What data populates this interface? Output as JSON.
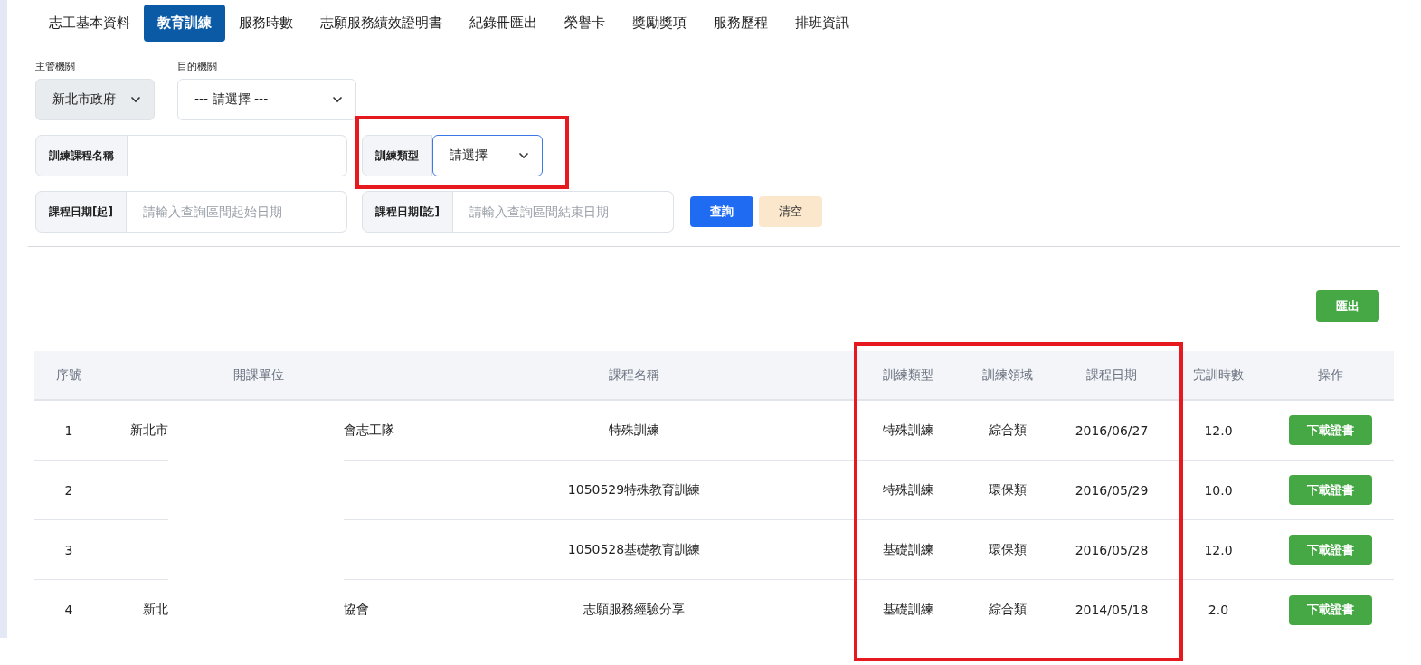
{
  "tabs": [
    {
      "label": "志工基本資料",
      "selected": false
    },
    {
      "label": "教育訓練",
      "selected": true
    },
    {
      "label": "服務時數",
      "selected": false
    },
    {
      "label": "志願服務績效證明書",
      "selected": false
    },
    {
      "label": "紀錄冊匯出",
      "selected": false
    },
    {
      "label": "榮譽卡",
      "selected": false
    },
    {
      "label": "獎勵獎項",
      "selected": false
    },
    {
      "label": "服務歷程",
      "selected": false
    },
    {
      "label": "排班資訊",
      "selected": false
    }
  ],
  "agency_selects": [
    {
      "label": "主管機關",
      "value": "新北市政府",
      "disabled": true
    },
    {
      "label": "目的機關",
      "value": "--- 請選擇 ---",
      "disabled": false
    }
  ],
  "filter_rows": [
    [
      {
        "kind": "input",
        "label": "訓練課程名稱",
        "focused": false
      },
      {
        "kind": "select",
        "label": "訓練類型",
        "value": "請選擇",
        "focused": true
      }
    ],
    [
      {
        "kind": "input",
        "label": "課程日期[起]",
        "placeholder": "請輸入查詢區間起始日期",
        "focused": false
      },
      {
        "kind": "input",
        "label": "課程日期[訖]",
        "placeholder": "請輸入查詢區間結束日期",
        "focused": false
      }
    ]
  ],
  "filter_buttons": [
    {
      "kind": "primary",
      "label": "查詢"
    },
    {
      "kind": "secondary",
      "label": "清空"
    }
  ],
  "export_button": "匯出",
  "table": {
    "columns": [
      "序號",
      "開課單位",
      "課程名稱",
      "訓練類型",
      "訓練領域",
      "課程日期",
      "完訓時數",
      "操作"
    ],
    "rows": [
      {
        "no": "1",
        "organizer_start": "新北市",
        "organizer_end": "會志工隊",
        "course": "特殊訓練",
        "type": "特殊訓練",
        "field": "綜合類",
        "date": "2016/06/27",
        "hours": "12.0",
        "action": "下載證書"
      },
      {
        "no": "2",
        "course": "1050529特殊教育訓練",
        "type": "特殊訓練",
        "field": "環保類",
        "date": "2016/05/29",
        "hours": "10.0",
        "action": "下載證書"
      },
      {
        "no": "3",
        "course": "1050528基礎教育訓練",
        "type": "基礎訓練",
        "field": "環保類",
        "date": "2016/05/28",
        "hours": "12.0",
        "action": "下載證書"
      },
      {
        "no": "4",
        "organizer_start": "新北",
        "organizer_end": "協會",
        "course": "志願服務經驗分享",
        "type": "基礎訓練",
        "field": "綜合類",
        "date": "2014/05/18",
        "hours": "2.0",
        "action": "下載證書"
      }
    ]
  }
}
